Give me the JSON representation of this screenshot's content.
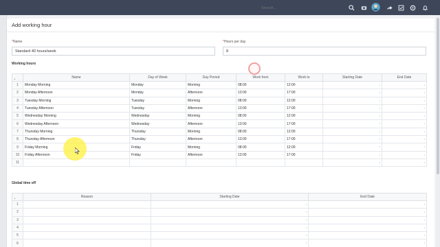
{
  "topbar": {
    "search_placeholder": "Search...",
    "icons": [
      "search-icon",
      "video-icon",
      "avatar",
      "share-icon",
      "tasks-icon",
      "settings-icon",
      "notifications-icon"
    ]
  },
  "page": {
    "title": "Add working hour"
  },
  "form": {
    "name_label": "Name",
    "name_value": "Standard 40 hours/week",
    "hours_label": "Hours per day",
    "hours_value": "8"
  },
  "working_hours": {
    "section_title": "Working hours",
    "columns": [
      "Name",
      "Day of Week",
      "Day Period",
      "Work from",
      "Work to",
      "Starting Date",
      "End Date"
    ],
    "rows": [
      {
        "n": "1",
        "name": "Monday Morning",
        "day": "Monday",
        "period": "Morning",
        "from": "08:00",
        "to": "12:00"
      },
      {
        "n": "2",
        "name": "Monday Afternoon",
        "day": "Monday",
        "period": "Afternoon",
        "from": "13:00",
        "to": "17:00"
      },
      {
        "n": "3",
        "name": "Tuesday Morning",
        "day": "Tuesday",
        "period": "Morning",
        "from": "08:00",
        "to": "12:00"
      },
      {
        "n": "4",
        "name": "Tuesday Afternoon",
        "day": "Tuesday",
        "period": "Afternoon",
        "from": "13:00",
        "to": "17:00"
      },
      {
        "n": "5",
        "name": "Wednesday Morning",
        "day": "Wednesday",
        "period": "Morning",
        "from": "08:00",
        "to": "12:00"
      },
      {
        "n": "6",
        "name": "Wednesday Afternoon",
        "day": "Wednesday",
        "period": "Afternoon",
        "from": "13:00",
        "to": "17:00"
      },
      {
        "n": "7",
        "name": "Thursday Morning",
        "day": "Thursday",
        "period": "Morning",
        "from": "08:00",
        "to": "12:00"
      },
      {
        "n": "8",
        "name": "Thursday Afternoon",
        "day": "Thursday",
        "period": "Afternoon",
        "from": "13:00",
        "to": "17:00"
      },
      {
        "n": "9",
        "name": "Friday Morning",
        "day": "Friday",
        "period": "Morning",
        "from": "08:00",
        "to": "12:00"
      },
      {
        "n": "10",
        "name": "Friday Afternoon",
        "day": "Friday",
        "period": "Afternoon",
        "from": "13:00",
        "to": "17:00"
      },
      {
        "n": "11",
        "name": "",
        "day": "",
        "period": "",
        "from": "",
        "to": ""
      }
    ]
  },
  "global_time_off": {
    "section_title": "Global time off",
    "columns": [
      "Reason",
      "Starting Date",
      "End Date"
    ],
    "rows": [
      "1",
      "2",
      "3",
      "4",
      "5",
      "6"
    ]
  }
}
